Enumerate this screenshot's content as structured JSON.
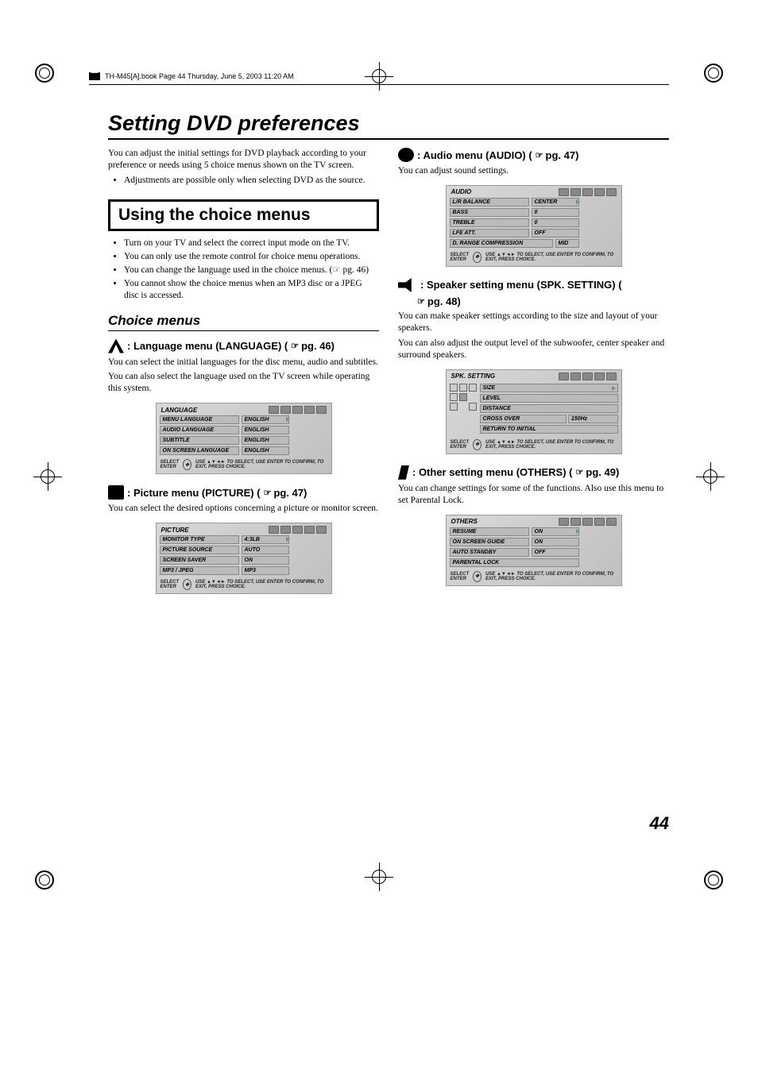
{
  "header": {
    "bookline": "TH-M45[A].book  Page 44  Thursday, June 5, 2003  11:20 AM"
  },
  "title": "Setting DVD preferences",
  "intro": "You can adjust the initial settings for DVD playback according to your preference or needs using 5 choice menus shown on the TV screen.",
  "intro_bullets": [
    "Adjustments are possible only when selecting DVD as the source."
  ],
  "using_title": "Using the choice menus",
  "using_bullets": [
    "Turn on your TV and select the correct input mode on the TV.",
    "You can only use the remote control for choice menu operations.",
    "You can change the language used in the choice menus. (☞ pg. 46)",
    "You cannot show the choice menus when an MP3 disc or a JPEG disc is accessed."
  ],
  "choice_title": "Choice menus",
  "menus": {
    "language": {
      "title": ": Language menu (LANGUAGE) (",
      "ref": "pg. 46)",
      "desc1": "You can select the initial languages for the disc menu, audio and subtitles.",
      "desc2": "You can also select the language used on the TV screen while operating this system.",
      "panel": {
        "title": "LANGUAGE",
        "rows": [
          {
            "lbl": "MENU LANGUAGE",
            "val": "ENGLISH",
            "cursor": true
          },
          {
            "lbl": "AUDIO LANGUAGE",
            "val": "ENGLISH"
          },
          {
            "lbl": "SUBTITLE",
            "val": "ENGLISH"
          },
          {
            "lbl": "ON SCREEN LANGUAGE",
            "val": "ENGLISH"
          }
        ]
      }
    },
    "picture": {
      "title": ": Picture menu (PICTURE) (",
      "ref": "pg. 47)",
      "desc1": "You can select the desired options concerning a picture or monitor screen.",
      "panel": {
        "title": "PICTURE",
        "rows": [
          {
            "lbl": "MONITOR TYPE",
            "val": "4:3LB",
            "cursor": true
          },
          {
            "lbl": "PICTURE SOURCE",
            "val": "AUTO"
          },
          {
            "lbl": "SCREEN SAVER",
            "val": "ON"
          },
          {
            "lbl": "MP3 / JPEG",
            "val": "MP3"
          }
        ]
      }
    },
    "audio": {
      "title": ": Audio menu (AUDIO) (",
      "ref": "pg. 47)",
      "desc1": "You can adjust sound settings.",
      "panel": {
        "title": "AUDIO",
        "rows": [
          {
            "lbl": "L/R BALANCE",
            "val": "CENTER",
            "cursor": true
          },
          {
            "lbl": "BASS",
            "val": "0"
          },
          {
            "lbl": "TREBLE",
            "val": "0"
          },
          {
            "lbl": "LFE ATT.",
            "val": "OFF"
          },
          {
            "lbl": "D. RANGE COMPRESSION",
            "val": "MID"
          }
        ]
      }
    },
    "speaker": {
      "title": ": Speaker setting menu (SPK. SETTING) (",
      "ref": "pg. 48)",
      "desc1": "You can make speaker settings according to the size and layout of your speakers.",
      "desc2": "You can also adjust the output level of the subwoofer, center speaker and surround speakers.",
      "panel": {
        "title": "SPK. SETTING",
        "items": [
          {
            "lbl": "SIZE",
            "cursor": true
          },
          {
            "lbl": "LEVEL"
          },
          {
            "lbl": "DISTANCE"
          }
        ],
        "rowitem": {
          "lbl": "CROSS OVER",
          "val": "150Hz"
        },
        "lastitem": "RETURN TO INITIAL"
      }
    },
    "others": {
      "title": ": Other setting menu (OTHERS) (",
      "ref": "pg. 49)",
      "desc1": "You can change settings for some of the functions. Also use this menu to set Parental Lock.",
      "panel": {
        "title": "OTHERS",
        "rows": [
          {
            "lbl": "RESUME",
            "val": "ON",
            "cursor": true
          },
          {
            "lbl": "ON SCREEN GUIDE",
            "val": "ON"
          },
          {
            "lbl": "AUTO STANDBY",
            "val": "OFF"
          },
          {
            "lbl": "PARENTAL LOCK",
            "val": ""
          }
        ]
      }
    }
  },
  "footer": {
    "select": "SELECT",
    "enter": "ENTER",
    "hint": "USE ▲▼◄► TO SELECT, USE ENTER TO CONFIRM, TO EXIT, PRESS CHOICE."
  },
  "pagenum": "44"
}
